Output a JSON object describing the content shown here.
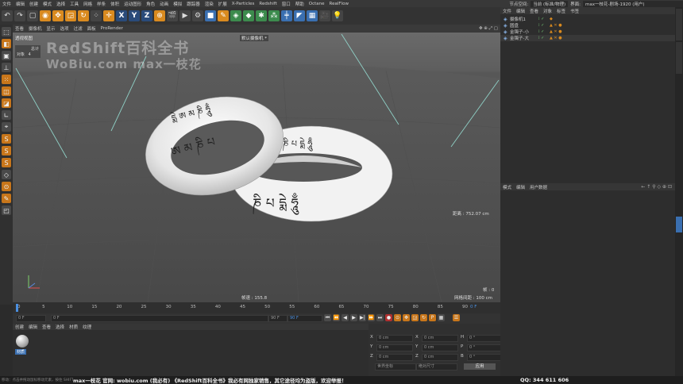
{
  "menubar": {
    "items": [
      "文件",
      "编辑",
      "创建",
      "模式",
      "选择",
      "工具",
      "网格",
      "样条",
      "体积",
      "运动图形",
      "角色",
      "动画",
      "模拟",
      "跟踪器",
      "渲染",
      "扩展",
      "X-Particles",
      "Redshift",
      "窗口",
      "帮助",
      "Octane",
      "RealFlow"
    ],
    "node_space_label": "节点空间:",
    "node_space_value": "当前 (标准/物理)",
    "layout_label": "界面:",
    "layout_value": "max一枝花-剧场-1920 (用户)"
  },
  "toolbar": {
    "axis_x": "X",
    "axis_y": "Y",
    "axis_z": "Z"
  },
  "viewport_menu": [
    "查看",
    "摄像机",
    "显示",
    "选项",
    "过滤",
    "面板",
    "ProRender"
  ],
  "viewport": {
    "view_name": "透视视图",
    "camera_label": "默认摄像机 *",
    "stats_total": "总计",
    "stats_objects_label": "对象",
    "stats_objects_value": "4",
    "distance": "距离 : 752.07 cm",
    "fps": "帧速 : 155.8",
    "frame": "帧 : 0",
    "grid": "网格间距 : 100 cm",
    "watermark_line1": "RedShift百科全书",
    "watermark_line2": "WoBiu.com  max一枝花",
    "glyphs": [
      "ཨ",
      "མ",
      "ཎི",
      "པ",
      "དྨེ",
      "ཧཱུྃ"
    ]
  },
  "timeline": {
    "ticks": [
      "0",
      "5",
      "10",
      "15",
      "20",
      "25",
      "30",
      "35",
      "40",
      "45",
      "50",
      "55",
      "60",
      "65",
      "70",
      "75",
      "80",
      "85",
      "90"
    ],
    "current_frame": "0 F"
  },
  "transport": {
    "start": "0 F",
    "current": "0 F",
    "end": "90 F",
    "end2": "90 F"
  },
  "material_menu": [
    "创建",
    "编辑",
    "查看",
    "选择",
    "材质",
    "纹理"
  ],
  "material_name": "材质",
  "coords": {
    "rows": [
      {
        "a": "X",
        "av": "0 cm",
        "b": "X",
        "bv": "0 cm",
        "c": "H",
        "cv": "0 °"
      },
      {
        "a": "Y",
        "av": "0 cm",
        "b": "Y",
        "bv": "0 cm",
        "c": "P",
        "cv": "0 °"
      },
      {
        "a": "Z",
        "av": "0 cm",
        "b": "Z",
        "bv": "0 cm",
        "c": "B",
        "cv": "0 °"
      }
    ],
    "mode1": "世界坐标",
    "mode2": "绝对尺寸",
    "apply": "应用"
  },
  "object_menu": [
    "文件",
    "编辑",
    "查看",
    "对象",
    "标签",
    "书签"
  ],
  "objects": [
    {
      "name": "摄像机1",
      "indent": 0
    },
    {
      "name": "圆盘",
      "indent": 0
    },
    {
      "name": "金镯子-小",
      "indent": 0
    },
    {
      "name": "金镯子-大",
      "indent": 0
    }
  ],
  "attr_menu": [
    "模式",
    "编辑",
    "用户数据"
  ],
  "statusbar": {
    "left": "移动：点击并拖动鼠标移动元素，按住 SHIFT 键量化移动；节点编辑模式时按住 SHIFT 键增加选择对象；按住 CTRL 键减少选择对象。",
    "banner": "max一枝花 官网: wobiu.com (我必有) 《RedShift百科全书》我必有网独家销售，其它途径均为盗版，欢迎举报！",
    "qq": "QQ: 344 611 606"
  },
  "colors": {
    "accent": "#d98a1f",
    "ring": "#efefef",
    "bg": "#2b2b2b"
  }
}
